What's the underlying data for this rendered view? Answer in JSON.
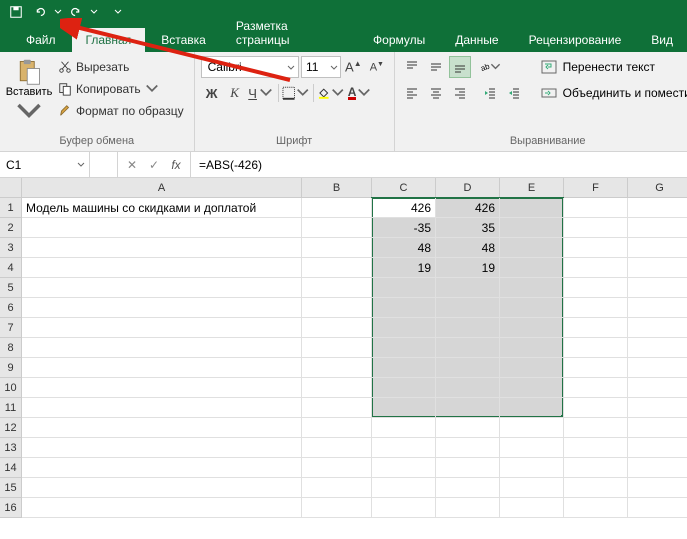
{
  "qat": {
    "save": "save",
    "undo": "undo",
    "redo": "redo"
  },
  "tabs": {
    "file": "Файл",
    "home": "Главная",
    "insert": "Вставка",
    "layout": "Разметка страницы",
    "formulas": "Формулы",
    "data": "Данные",
    "review": "Рецензирование",
    "view": "Вид"
  },
  "ribbon": {
    "clipboard": {
      "paste": "Вставить",
      "cut": "Вырезать",
      "copy": "Копировать",
      "format_painter": "Формат по образцу",
      "label": "Буфер обмена"
    },
    "font": {
      "name": "Calibri",
      "size": "11",
      "bold": "Ж",
      "italic": "К",
      "underline": "Ч",
      "label": "Шрифт"
    },
    "alignment": {
      "wrap": "Перенести текст",
      "merge": "Объединить и помести",
      "label": "Выравнивание"
    }
  },
  "namebox": "C1",
  "formula": "=ABS(-426)",
  "columns": [
    "A",
    "B",
    "C",
    "D",
    "E",
    "F",
    "G"
  ],
  "rows": [
    1,
    2,
    3,
    4,
    5,
    6,
    7,
    8,
    9,
    10,
    11,
    12,
    13,
    14,
    15,
    16
  ],
  "cells": {
    "A1": "Модель машины со скидками и доплатой",
    "C1": "426",
    "D1": "426",
    "C2": "-35",
    "D2": "35",
    "C3": "48",
    "D3": "48",
    "C4": "19",
    "D4": "19"
  }
}
